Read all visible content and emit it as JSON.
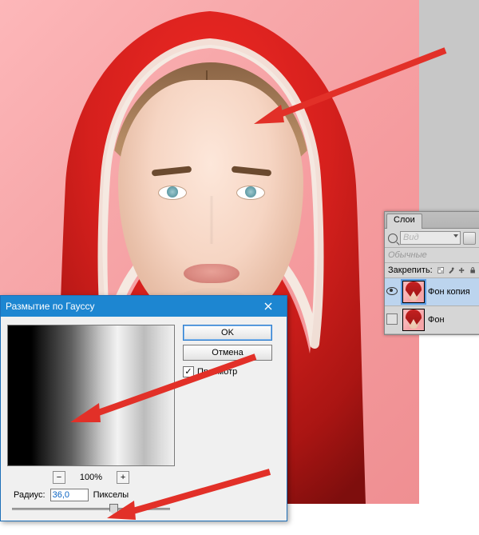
{
  "layers_panel": {
    "tab_label": "Слои",
    "filter_placeholder": "Вид",
    "blend_placeholder": "Обычные",
    "lock_label": "Закрепить:",
    "items": [
      {
        "name": "Фон копия",
        "visible": true,
        "selected": true
      },
      {
        "name": "Фон",
        "visible": false,
        "selected": false
      }
    ]
  },
  "dialog": {
    "title": "Размытие по Гауссу",
    "ok_label": "OK",
    "cancel_label": "Отмена",
    "preview_label": "Просмотр",
    "preview_checked": "✓",
    "zoom_value": "100%",
    "radius_label": "Радиус:",
    "radius_value": "36,0",
    "radius_unit": "Пикселы",
    "minus": "−",
    "plus": "+"
  }
}
